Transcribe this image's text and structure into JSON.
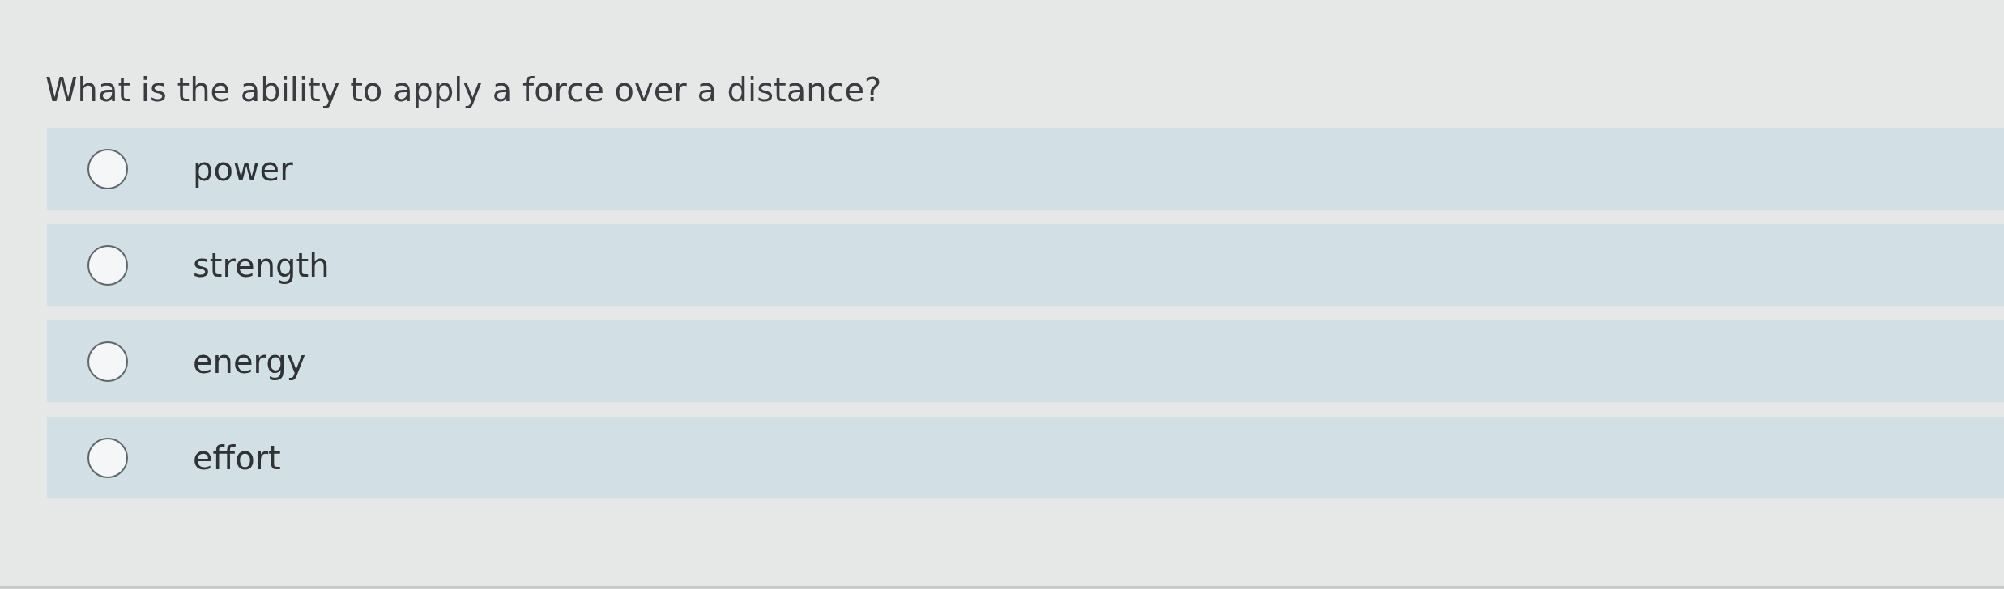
{
  "question": "What is the ability to apply a force over a distance?",
  "options": [
    {
      "label": "power",
      "selected": false
    },
    {
      "label": "strength",
      "selected": false
    },
    {
      "label": "energy",
      "selected": false
    },
    {
      "label": "effort",
      "selected": false
    }
  ]
}
